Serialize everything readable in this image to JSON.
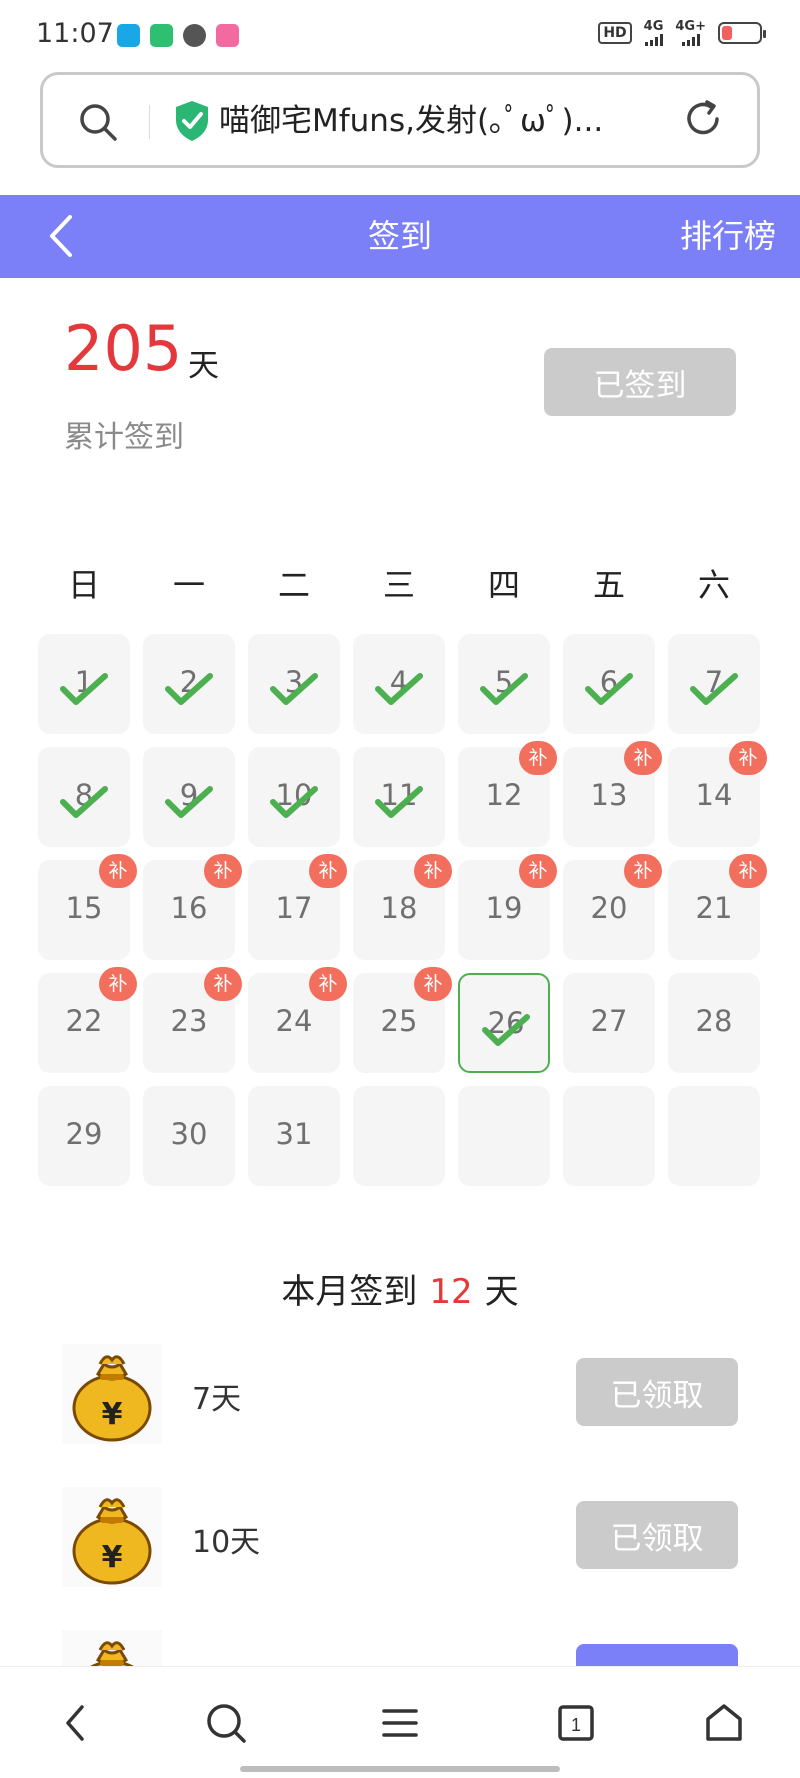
{
  "status_bar": {
    "time": "11:07",
    "app_icons": [
      "browser-app-icon",
      "video-app-icon",
      "fan-app-icon",
      "bilibili-app-icon"
    ],
    "hd": "HD",
    "sim1_net": "4G",
    "sim2_net": "4G+",
    "battery_color": "#f36060"
  },
  "browser": {
    "page_title": "喵御宅Mfuns,发射(｡ﾟωﾟ)..."
  },
  "header": {
    "title": "签到",
    "right_label": "排行榜",
    "color": "#7b7ff8"
  },
  "summary": {
    "total_days": "205",
    "unit": "天",
    "label": "累计签到",
    "button_label": "已签到"
  },
  "calendar": {
    "weekdays": [
      "日",
      "一",
      "二",
      "三",
      "四",
      "五",
      "六"
    ],
    "makeup_label": "补",
    "days": [
      {
        "day": "1",
        "status": "signed"
      },
      {
        "day": "2",
        "status": "signed"
      },
      {
        "day": "3",
        "status": "signed"
      },
      {
        "day": "4",
        "status": "signed"
      },
      {
        "day": "5",
        "status": "signed"
      },
      {
        "day": "6",
        "status": "signed"
      },
      {
        "day": "7",
        "status": "signed"
      },
      {
        "day": "8",
        "status": "signed"
      },
      {
        "day": "9",
        "status": "signed"
      },
      {
        "day": "10",
        "status": "signed"
      },
      {
        "day": "11",
        "status": "signed"
      },
      {
        "day": "12",
        "status": "makeup"
      },
      {
        "day": "13",
        "status": "makeup"
      },
      {
        "day": "14",
        "status": "makeup"
      },
      {
        "day": "15",
        "status": "makeup"
      },
      {
        "day": "16",
        "status": "makeup"
      },
      {
        "day": "17",
        "status": "makeup"
      },
      {
        "day": "18",
        "status": "makeup"
      },
      {
        "day": "19",
        "status": "makeup"
      },
      {
        "day": "20",
        "status": "makeup"
      },
      {
        "day": "21",
        "status": "makeup"
      },
      {
        "day": "22",
        "status": "makeup"
      },
      {
        "day": "23",
        "status": "makeup"
      },
      {
        "day": "24",
        "status": "makeup"
      },
      {
        "day": "25",
        "status": "makeup"
      },
      {
        "day": "26",
        "status": "today-signed"
      },
      {
        "day": "27",
        "status": "future"
      },
      {
        "day": "28",
        "status": "future"
      },
      {
        "day": "29",
        "status": "future"
      },
      {
        "day": "30",
        "status": "future"
      },
      {
        "day": "31",
        "status": "future"
      },
      {
        "day": "",
        "status": "empty"
      },
      {
        "day": "",
        "status": "empty"
      },
      {
        "day": "",
        "status": "empty"
      },
      {
        "day": "",
        "status": "empty"
      }
    ],
    "check_color": "#4caf50",
    "badge_color": "#f26f5d"
  },
  "month": {
    "prefix": "本月签到",
    "count": "12",
    "suffix": "天"
  },
  "rewards": [
    {
      "label": "7天",
      "button": "已领取",
      "state": "claimed",
      "icon": "money-bag-icon"
    },
    {
      "label": "10天",
      "button": "已领取",
      "state": "claimed",
      "icon": "money-bag-icon"
    },
    {
      "label": "",
      "button": "",
      "state": "active",
      "icon": "money-bag-icon"
    }
  ],
  "bottom_nav": [
    "back-icon",
    "search-icon",
    "menu-icon",
    "tabs-icon",
    "home-icon"
  ],
  "tab_count": "1"
}
